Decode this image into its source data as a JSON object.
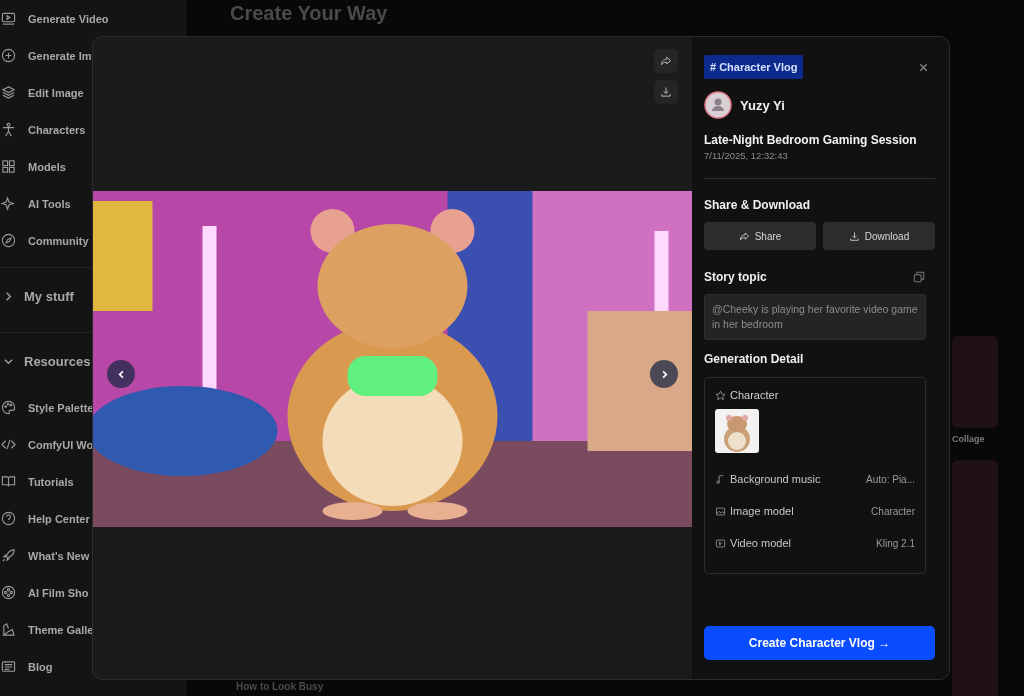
{
  "background": {
    "heading": "Create Your Way",
    "side_caption": "Collage",
    "bottom_caption": "How to Look Busy"
  },
  "sidebar": {
    "items": [
      "Generate Video",
      "Generate Im",
      "Edit Image",
      "Characters",
      "Models",
      "AI Tools",
      "Community"
    ],
    "sections": [
      {
        "label": "My stuff",
        "expanded": false
      },
      {
        "label": "Resources",
        "expanded": true,
        "items": [
          "Style Palette",
          "ComfyUI Wo",
          "Tutorials",
          "Help Center",
          "What's New",
          "AI Film Sho",
          "Theme Galle",
          "Blog"
        ]
      }
    ]
  },
  "modal": {
    "tag": "# Character Vlog",
    "author": "Yuzy Yi",
    "title": "Late-Night Bedroom Gaming Session",
    "date": "7/11/2025, 12:32:43",
    "share": {
      "heading": "Share & Download",
      "buttons": [
        "Share",
        "Download"
      ]
    },
    "story_topic": {
      "heading": "Story topic",
      "text": "@Cheeky is playing her favorite video game in her bedroom"
    },
    "generation_detail": {
      "heading": "Generation Detail",
      "character_label": "Character",
      "rows": [
        {
          "label": "Background music",
          "value": "Auto: Pia..."
        },
        {
          "label": "Image model",
          "value": "Character"
        },
        {
          "label": "Video model",
          "value": "Kling 2.1"
        }
      ]
    },
    "cta": "Create Character Vlog →"
  }
}
